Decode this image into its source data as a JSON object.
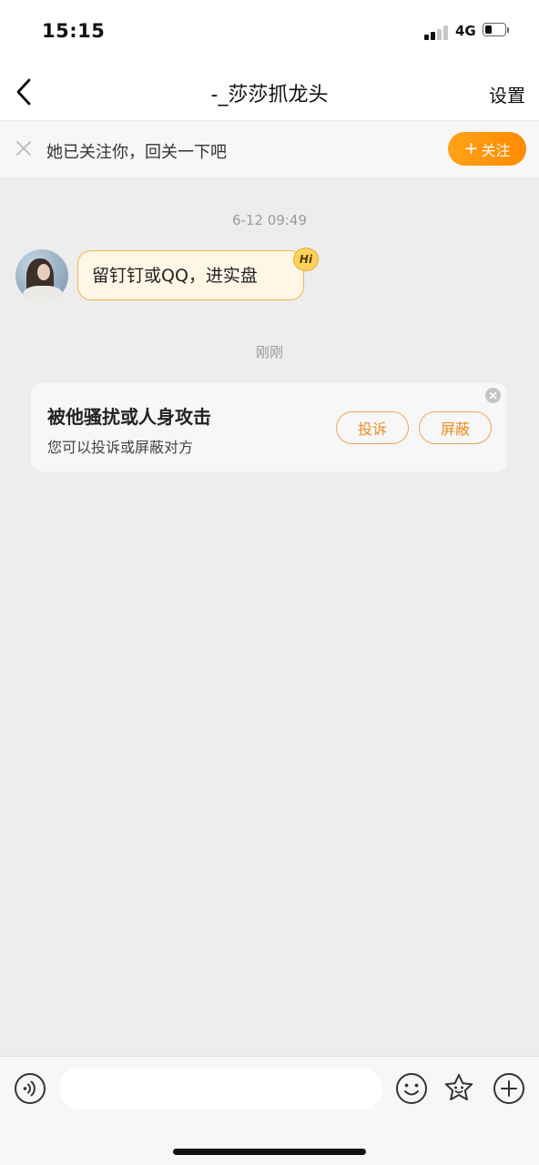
{
  "status_bar": {
    "time": "15:15",
    "network": "4G",
    "signal_bars_filled": 2,
    "signal_bars_total": 4,
    "battery_level": 0.35
  },
  "nav": {
    "back_icon": "chevron-left-icon",
    "title": "-_莎莎抓龙头",
    "settings_label": "设置"
  },
  "follow_banner": {
    "close_icon": "close-icon",
    "text": "她已关注你，回关一下吧",
    "follow_button_label": "关注",
    "follow_button_icon": "+",
    "accent_color": "#ff9500"
  },
  "chat": {
    "messages": [
      {
        "timestamp": "6-12 09:49",
        "sender": "other",
        "text": "留钉钉或QQ，进实盘",
        "badge": "Hi"
      }
    ],
    "system_timestamp": "刚刚",
    "report_card": {
      "title": "被他骚扰或人身攻击",
      "subtitle": "您可以投诉或屏蔽对方",
      "complain_label": "投诉",
      "block_label": "屏蔽",
      "close_icon": "close-circle-icon"
    }
  },
  "input_bar": {
    "placeholder": "",
    "voice_icon": "voice-icon",
    "emoji_icon": "emoji-icon",
    "sticker_icon": "sticker-icon",
    "plus_icon": "plus-circle-icon"
  }
}
